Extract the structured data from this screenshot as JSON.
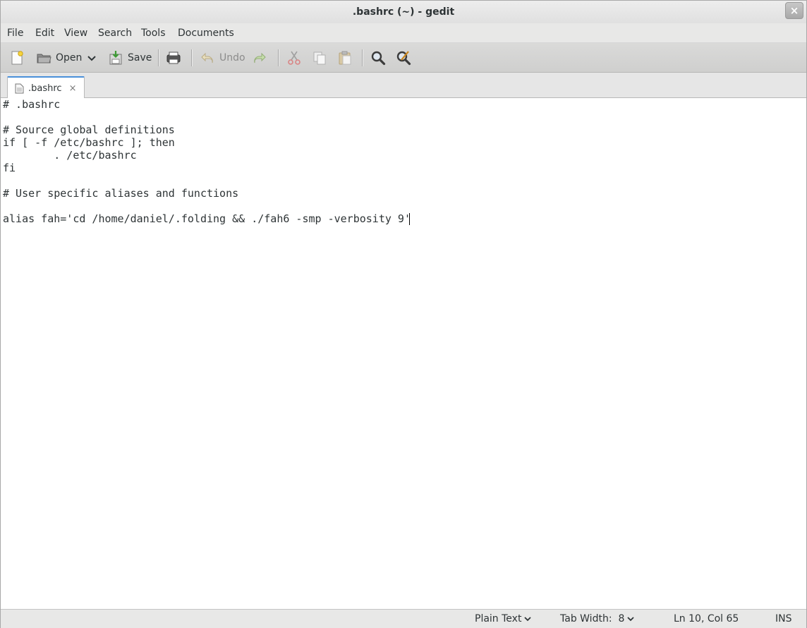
{
  "window": {
    "title": ".bashrc (~) - gedit",
    "close_glyph": "×"
  },
  "menubar": {
    "items": [
      "File",
      "Edit",
      "View",
      "Search",
      "Tools",
      "Documents"
    ]
  },
  "toolbar": {
    "new_icon": "new-document-icon",
    "open_label": "Open",
    "save_label": "Save",
    "undo_label": "Undo",
    "icons": [
      "new-document-icon",
      "open-folder-icon",
      "chevron-down-icon",
      "save-icon",
      "print-icon",
      "undo-icon",
      "redo-icon",
      "cut-icon",
      "copy-icon",
      "paste-icon",
      "find-icon",
      "find-replace-icon"
    ]
  },
  "tabs": [
    {
      "label": ".bashrc",
      "close_glyph": "×"
    }
  ],
  "editor": {
    "lines": [
      "# .bashrc",
      "",
      "# Source global definitions",
      "if [ -f /etc/bashrc ]; then",
      "        . /etc/bashrc",
      "fi",
      "",
      "# User specific aliases and functions",
      "",
      "alias fah='cd /home/daniel/.folding && ./fah6 -smp -verbosity 9'"
    ]
  },
  "statusbar": {
    "language": "Plain Text",
    "tab_width": "Tab Width:  8",
    "position": "Ln 10, Col 65",
    "mode": "INS"
  },
  "colors": {
    "accent": "#4a90d9",
    "text": "#2e3436",
    "disabled": "#8c8c8c"
  }
}
